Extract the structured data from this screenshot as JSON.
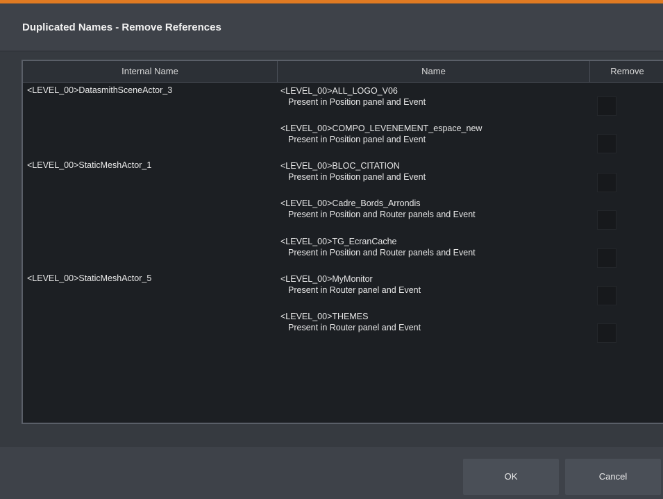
{
  "dialog": {
    "title": "Duplicated Names - Remove References"
  },
  "table": {
    "headers": {
      "internal_name": "Internal Name",
      "name": "Name",
      "remove": "Remove"
    },
    "groups": [
      {
        "internal_name": "<LEVEL_00>DatasmithSceneActor_3",
        "items": [
          {
            "name": "<LEVEL_00>ALL_LOGO_V06",
            "detail": "Present in Position panel and Event",
            "remove": false
          },
          {
            "name": "<LEVEL_00>COMPO_LEVENEMENT_espace_new",
            "detail": "Present in Position panel and Event",
            "remove": false
          }
        ]
      },
      {
        "internal_name": "<LEVEL_00>StaticMeshActor_1",
        "items": [
          {
            "name": "<LEVEL_00>BLOC_CITATION",
            "detail": "Present in Position panel and Event",
            "remove": false
          },
          {
            "name": "<LEVEL_00>Cadre_Bords_Arrondis",
            "detail": "Present in Position and Router panels and Event",
            "remove": false
          },
          {
            "name": "<LEVEL_00>TG_EcranCache",
            "detail": "Present in Position and Router panels and Event",
            "remove": false
          }
        ]
      },
      {
        "internal_name": "<LEVEL_00>StaticMeshActor_5",
        "items": [
          {
            "name": "<LEVEL_00>MyMonitor",
            "detail": "Present in Router panel and Event",
            "remove": false
          },
          {
            "name": "<LEVEL_00>THEMES",
            "detail": "Present in Router panel and Event",
            "remove": false
          }
        ]
      }
    ]
  },
  "footer": {
    "ok_label": "OK",
    "cancel_label": "Cancel"
  },
  "colors": {
    "accent": "#e07a22",
    "background": "#3b3f47",
    "table_background": "#1c1f23"
  }
}
